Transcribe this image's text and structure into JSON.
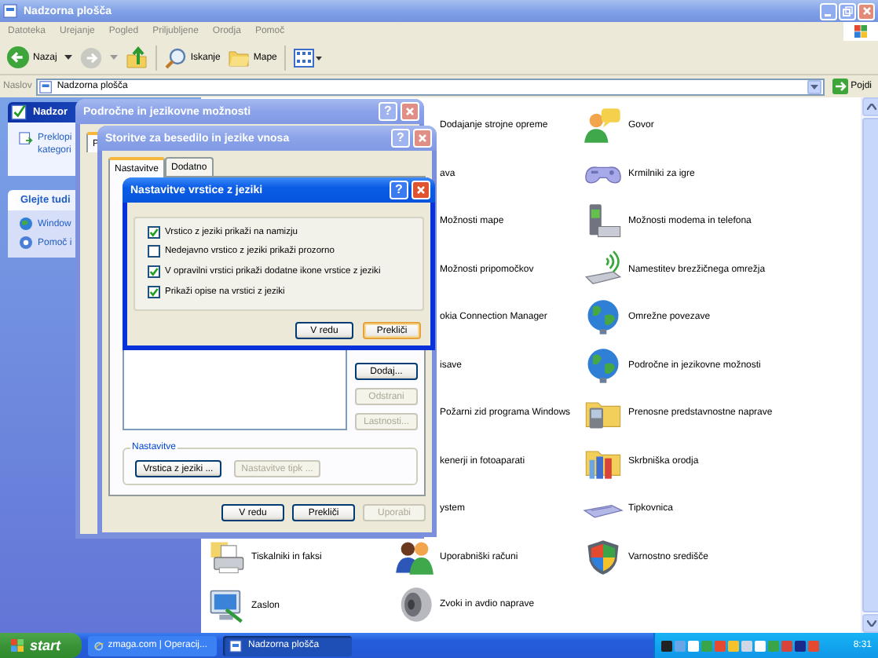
{
  "window": {
    "title": "Nadzorna plošča"
  },
  "menu": [
    "Datoteka",
    "Urejanje",
    "Pogled",
    "Priljubljene",
    "Orodja",
    "Pomoč"
  ],
  "toolbar": {
    "back": "Nazaj",
    "search": "Iskanje",
    "folders": "Mape"
  },
  "address": {
    "label": "Naslov",
    "value": "Nadzorna plošča",
    "go": "Pojdi"
  },
  "task_pane": {
    "header": "Nadzor",
    "switch_link": "Preklopi kategori",
    "see_also": {
      "title": "Glejte tudi",
      "items": [
        "Window",
        "Pomoč i"
      ]
    }
  },
  "content": {
    "columns": [
      [
        {
          "label": "Tiskalniki in faksi",
          "kind": "icon"
        },
        {
          "label": "Zaslon",
          "kind": "icon"
        }
      ],
      [
        {
          "label": "Dodajanje strojne opreme",
          "kind": "partial"
        },
        {
          "label": "ava",
          "kind": "partial"
        },
        {
          "label": "Možnosti mape",
          "kind": "partial"
        },
        {
          "label": "Možnosti pripomočkov",
          "kind": "partial"
        },
        {
          "label": "okia Connection Manager",
          "kind": "partial"
        },
        {
          "label": "isave",
          "kind": "partial"
        },
        {
          "label": "Požarni zid programa Windows",
          "kind": "partial"
        },
        {
          "label": "kenerji in fotoaparati",
          "kind": "partial"
        },
        {
          "label": "ystem",
          "kind": "partial"
        },
        {
          "label": "Uporabniški računi",
          "kind": "icon"
        },
        {
          "label": "Zvoki in avdio naprave",
          "kind": "icon"
        }
      ],
      [
        {
          "label": "Govor",
          "kind": "icon"
        },
        {
          "label": "Krmilniki za igre",
          "kind": "icon"
        },
        {
          "label": "Možnosti modema in telefona",
          "kind": "icon"
        },
        {
          "label": "Namestitev brezžičnega omrežja",
          "kind": "icon"
        },
        {
          "label": "Omrežne povezave",
          "kind": "icon"
        },
        {
          "label": "Področne in jezikovne možnosti",
          "kind": "icon"
        },
        {
          "label": "Prenosne predstavnostne naprave",
          "kind": "icon"
        },
        {
          "label": "Skrbniška orodja",
          "kind": "icon"
        },
        {
          "label": "Tipkovnica",
          "kind": "icon"
        },
        {
          "label": "Varnostno središče",
          "kind": "icon"
        }
      ]
    ]
  },
  "regional_dialog": {
    "title": "Področne in jezikovne možnosti",
    "active": false,
    "help": "?",
    "tabs": [
      {
        "label": "P",
        "selected": true
      }
    ]
  },
  "text_services_dialog": {
    "title": "Storitve za besedilo in jezike vnosa",
    "active": false,
    "help": "?",
    "tabs": [
      {
        "label": "Nastavitve",
        "selected": true
      },
      {
        "label": "Dodatno",
        "selected": false
      }
    ],
    "side_buttons": [
      {
        "label": "Dodaj...",
        "disabled": false
      },
      {
        "label": "Odstrani",
        "disabled": true
      },
      {
        "label": "Lastnosti...",
        "disabled": true
      }
    ],
    "group": {
      "title": "Nastavitve",
      "buttons": [
        {
          "label": "Vrstica z jeziki ...",
          "disabled": false
        },
        {
          "label": "Nastavitve tipk ...",
          "disabled": true
        }
      ]
    },
    "buttons": [
      {
        "label": "V redu",
        "disabled": false
      },
      {
        "label": "Prekliči",
        "disabled": false
      },
      {
        "label": "Uporabi",
        "disabled": true
      }
    ]
  },
  "language_bar_dialog": {
    "title": "Nastavitve vrstice z jeziki",
    "active": true,
    "help": "?",
    "options": [
      {
        "label": "Vrstico z jeziki prikaži na namizju",
        "checked": true
      },
      {
        "label": "Nedejavno vrstico z jeziki prikaži prozorno",
        "checked": false
      },
      {
        "label": "V opravilni vrstici prikaži dodatne ikone vrstice z jeziki",
        "checked": true
      },
      {
        "label": "Prikaži opise na vrstici z jeziki",
        "checked": true
      }
    ],
    "buttons": [
      {
        "label": "V redu",
        "focused": false
      },
      {
        "label": "Prekliči",
        "focused": true
      }
    ]
  },
  "taskbar": {
    "start": "start",
    "tasks": [
      {
        "label": "zmaga.com | Operacij...",
        "selected": false
      },
      {
        "label": "Nadzorna plošča",
        "selected": true
      }
    ],
    "clock": "8:31"
  }
}
